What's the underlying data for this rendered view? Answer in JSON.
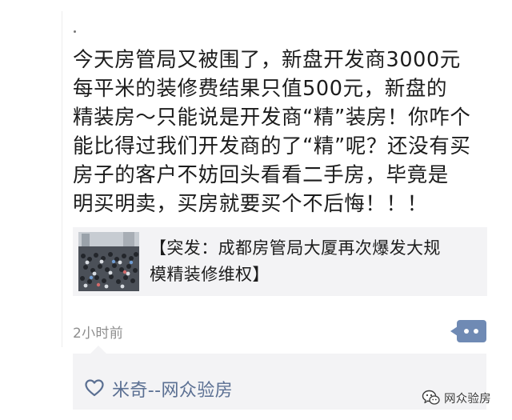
{
  "post": {
    "lines": [
      "今天房管局又被围了，新盘开发商3000元",
      "每平米的装修费结果只值500元，新盘的",
      "精装房～只能说是开发商“精”装房！你咋个",
      "能比得过我们开发商的了“精”呢？还没有买",
      "房子的客户不妨回头看看二手房，毕竟是",
      "明买明卖，买房就要买个不后悔！！！"
    ]
  },
  "link_card": {
    "title_lines": [
      "【突发：成都房管局大厦再次爆发大规",
      "模精装修维权】"
    ],
    "thumbnail_icon": "crowd-photo-thumbnail"
  },
  "meta": {
    "timestamp": "2小时前",
    "comment_icon": "comment-dots-icon"
  },
  "likes": {
    "icon": "heart-icon",
    "names": "米奇--网众验房"
  },
  "watermark": {
    "icon": "wechat-icon",
    "text": "网众验房"
  },
  "colors": {
    "link_blue": "#5a6f92",
    "comment_button": "#6f8ab4",
    "card_bg": "#f3f3f5"
  }
}
